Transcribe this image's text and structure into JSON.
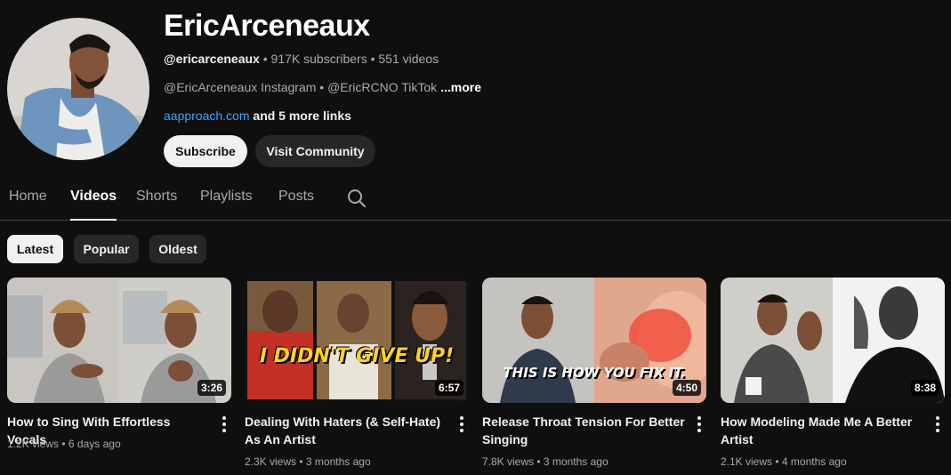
{
  "channel": {
    "name": "EricArceneaux",
    "handle": "@ericarceneaux",
    "subscribers": "917K subscribers",
    "videos_count": "551 videos",
    "description": "@EricArceneaux Instagram • @EricRCNO TikTok",
    "more_label": "...more",
    "link": "aapproach.com",
    "more_links": "and 5 more links"
  },
  "buttons": {
    "subscribe": "Subscribe",
    "community": "Visit Community"
  },
  "tabs": [
    "Home",
    "Videos",
    "Shorts",
    "Playlists",
    "Posts"
  ],
  "active_tab": "Videos",
  "chips": [
    "Latest",
    "Popular",
    "Oldest"
  ],
  "active_chip": "Latest",
  "videos": [
    {
      "title": "How to Sing With Effortless Vocals",
      "views": "1.2K views",
      "age": "6 days ago",
      "duration": "3:26",
      "overlay": ""
    },
    {
      "title": "Dealing With Haters (& Self-Hate) As An Artist",
      "views": "2.3K views",
      "age": "3 months ago",
      "duration": "6:57",
      "overlay": "I DIDN'T GIVE UP!"
    },
    {
      "title": "Release Throat Tension For Better Singing",
      "views": "7.8K views",
      "age": "3 months ago",
      "duration": "4:50",
      "overlay": "THIS IS HOW YOU FIX IT."
    },
    {
      "title": "How Modeling Made Me A Better Artist",
      "views": "2.1K views",
      "age": "4 months ago",
      "duration": "8:38",
      "overlay": ""
    }
  ],
  "separator": "•",
  "icons": {
    "search": "search-icon",
    "menu": "more-vert-icon"
  },
  "colors": {
    "background": "#0f0f0f",
    "link": "#3ea6ff",
    "overlay_yellow": "#ffd21f"
  }
}
